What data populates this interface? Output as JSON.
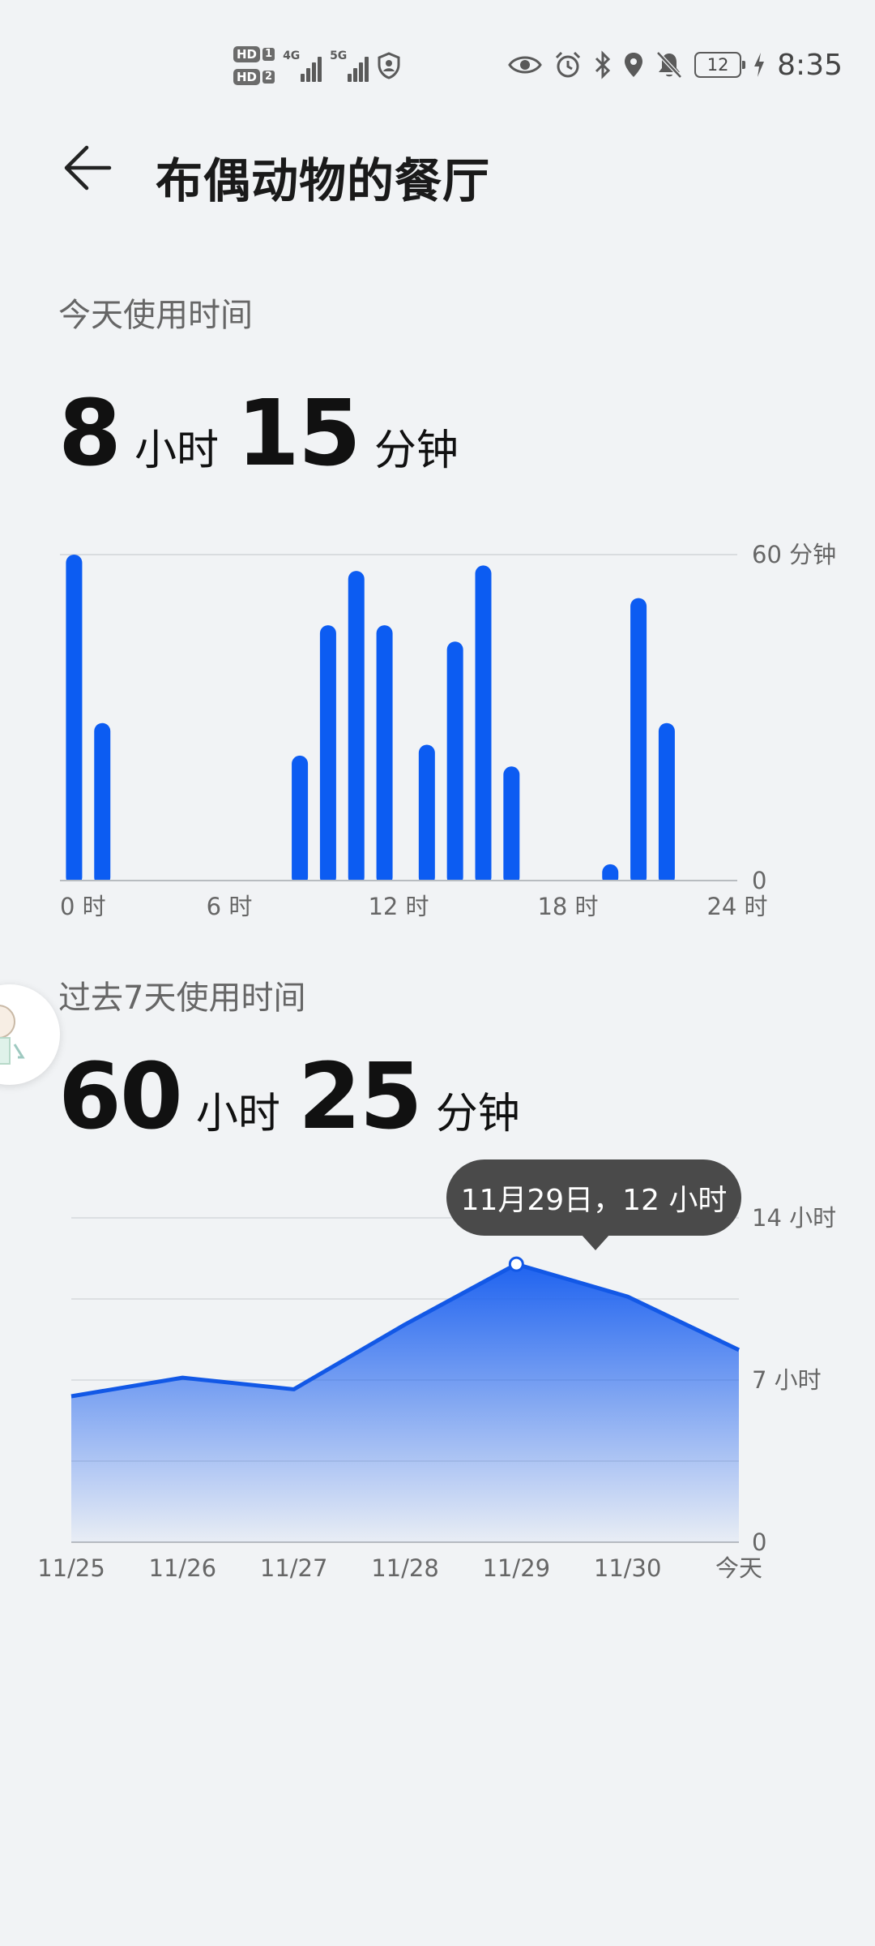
{
  "status_bar": {
    "sim1": "HD",
    "sim1_num": "1",
    "sim2": "HD",
    "sim2_num": "2",
    "net1": "4G",
    "net2": "5G",
    "battery": "12",
    "time": "8:35",
    "icons": [
      "shield-icon",
      "eye-icon",
      "alarm-icon",
      "bluetooth-icon",
      "location-icon",
      "bell-off-icon",
      "charging-icon"
    ]
  },
  "header": {
    "back_icon": "arrow-left-icon",
    "title": "布偶动物的餐厅"
  },
  "today": {
    "label": "今天使用时间",
    "hours": "8",
    "hours_unit": "小时",
    "minutes": "15",
    "minutes_unit": "分钟"
  },
  "week": {
    "label": "过去7天使用时间",
    "hours": "60",
    "hours_unit": "小时",
    "minutes": "25",
    "minutes_unit": "分钟",
    "tooltip": "11月29日，12 小时"
  },
  "colors": {
    "accent": "#0c5cf2",
    "bg": "#f1f3f5"
  },
  "chart_data": [
    {
      "type": "bar",
      "x_ticks": [
        "0 时",
        "6 时",
        "12 时",
        "18 时",
        "24 时"
      ],
      "y_ticks": [
        "60 分钟",
        "0"
      ],
      "ylim": [
        0,
        60
      ],
      "xlim": [
        0,
        24
      ],
      "bars": [
        {
          "hour": 0.5,
          "value": 60
        },
        {
          "hour": 1.5,
          "value": 29
        },
        {
          "hour": 8.5,
          "value": 23
        },
        {
          "hour": 9.5,
          "value": 47
        },
        {
          "hour": 10.5,
          "value": 57
        },
        {
          "hour": 11.5,
          "value": 47
        },
        {
          "hour": 13.0,
          "value": 25
        },
        {
          "hour": 14.0,
          "value": 44
        },
        {
          "hour": 15.0,
          "value": 58
        },
        {
          "hour": 16.0,
          "value": 21
        },
        {
          "hour": 19.5,
          "value": 3
        },
        {
          "hour": 20.5,
          "value": 52
        },
        {
          "hour": 21.5,
          "value": 29
        }
      ]
    },
    {
      "type": "area",
      "categories": [
        "11/25",
        "11/26",
        "11/27",
        "11/28",
        "11/29",
        "11/30",
        "今天"
      ],
      "values": [
        6.3,
        7.1,
        6.6,
        9.4,
        12.0,
        10.6,
        8.3
      ],
      "y_ticks": [
        "14 小时",
        "7 小时",
        "0"
      ],
      "ylim": [
        0,
        14
      ],
      "highlight_index": 4
    }
  ]
}
